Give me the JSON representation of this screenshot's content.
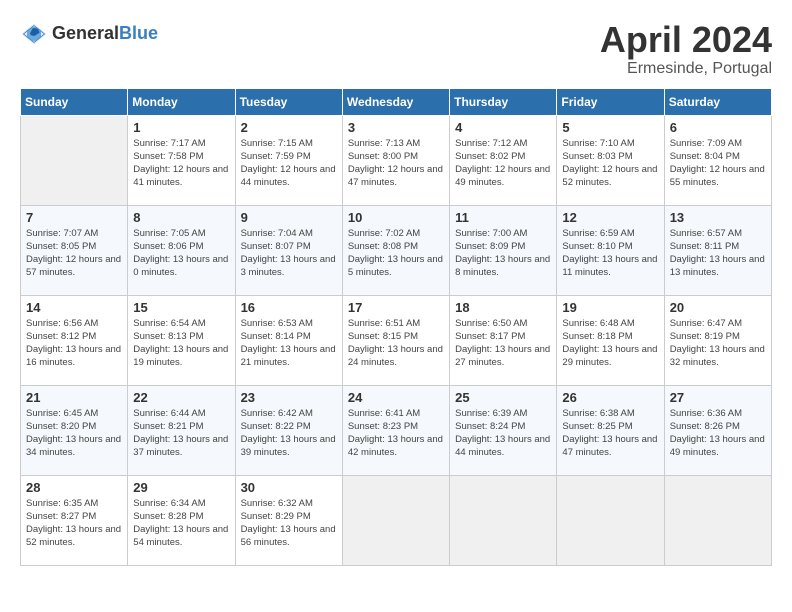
{
  "header": {
    "logo_general": "General",
    "logo_blue": "Blue",
    "title": "April 2024",
    "subtitle": "Ermesinde, Portugal"
  },
  "days_of_week": [
    "Sunday",
    "Monday",
    "Tuesday",
    "Wednesday",
    "Thursday",
    "Friday",
    "Saturday"
  ],
  "weeks": [
    [
      {
        "day": "",
        "sunrise": "",
        "sunset": "",
        "daylight": ""
      },
      {
        "day": "1",
        "sunrise": "Sunrise: 7:17 AM",
        "sunset": "Sunset: 7:58 PM",
        "daylight": "Daylight: 12 hours and 41 minutes."
      },
      {
        "day": "2",
        "sunrise": "Sunrise: 7:15 AM",
        "sunset": "Sunset: 7:59 PM",
        "daylight": "Daylight: 12 hours and 44 minutes."
      },
      {
        "day": "3",
        "sunrise": "Sunrise: 7:13 AM",
        "sunset": "Sunset: 8:00 PM",
        "daylight": "Daylight: 12 hours and 47 minutes."
      },
      {
        "day": "4",
        "sunrise": "Sunrise: 7:12 AM",
        "sunset": "Sunset: 8:02 PM",
        "daylight": "Daylight: 12 hours and 49 minutes."
      },
      {
        "day": "5",
        "sunrise": "Sunrise: 7:10 AM",
        "sunset": "Sunset: 8:03 PM",
        "daylight": "Daylight: 12 hours and 52 minutes."
      },
      {
        "day": "6",
        "sunrise": "Sunrise: 7:09 AM",
        "sunset": "Sunset: 8:04 PM",
        "daylight": "Daylight: 12 hours and 55 minutes."
      }
    ],
    [
      {
        "day": "7",
        "sunrise": "Sunrise: 7:07 AM",
        "sunset": "Sunset: 8:05 PM",
        "daylight": "Daylight: 12 hours and 57 minutes."
      },
      {
        "day": "8",
        "sunrise": "Sunrise: 7:05 AM",
        "sunset": "Sunset: 8:06 PM",
        "daylight": "Daylight: 13 hours and 0 minutes."
      },
      {
        "day": "9",
        "sunrise": "Sunrise: 7:04 AM",
        "sunset": "Sunset: 8:07 PM",
        "daylight": "Daylight: 13 hours and 3 minutes."
      },
      {
        "day": "10",
        "sunrise": "Sunrise: 7:02 AM",
        "sunset": "Sunset: 8:08 PM",
        "daylight": "Daylight: 13 hours and 5 minutes."
      },
      {
        "day": "11",
        "sunrise": "Sunrise: 7:00 AM",
        "sunset": "Sunset: 8:09 PM",
        "daylight": "Daylight: 13 hours and 8 minutes."
      },
      {
        "day": "12",
        "sunrise": "Sunrise: 6:59 AM",
        "sunset": "Sunset: 8:10 PM",
        "daylight": "Daylight: 13 hours and 11 minutes."
      },
      {
        "day": "13",
        "sunrise": "Sunrise: 6:57 AM",
        "sunset": "Sunset: 8:11 PM",
        "daylight": "Daylight: 13 hours and 13 minutes."
      }
    ],
    [
      {
        "day": "14",
        "sunrise": "Sunrise: 6:56 AM",
        "sunset": "Sunset: 8:12 PM",
        "daylight": "Daylight: 13 hours and 16 minutes."
      },
      {
        "day": "15",
        "sunrise": "Sunrise: 6:54 AM",
        "sunset": "Sunset: 8:13 PM",
        "daylight": "Daylight: 13 hours and 19 minutes."
      },
      {
        "day": "16",
        "sunrise": "Sunrise: 6:53 AM",
        "sunset": "Sunset: 8:14 PM",
        "daylight": "Daylight: 13 hours and 21 minutes."
      },
      {
        "day": "17",
        "sunrise": "Sunrise: 6:51 AM",
        "sunset": "Sunset: 8:15 PM",
        "daylight": "Daylight: 13 hours and 24 minutes."
      },
      {
        "day": "18",
        "sunrise": "Sunrise: 6:50 AM",
        "sunset": "Sunset: 8:17 PM",
        "daylight": "Daylight: 13 hours and 27 minutes."
      },
      {
        "day": "19",
        "sunrise": "Sunrise: 6:48 AM",
        "sunset": "Sunset: 8:18 PM",
        "daylight": "Daylight: 13 hours and 29 minutes."
      },
      {
        "day": "20",
        "sunrise": "Sunrise: 6:47 AM",
        "sunset": "Sunset: 8:19 PM",
        "daylight": "Daylight: 13 hours and 32 minutes."
      }
    ],
    [
      {
        "day": "21",
        "sunrise": "Sunrise: 6:45 AM",
        "sunset": "Sunset: 8:20 PM",
        "daylight": "Daylight: 13 hours and 34 minutes."
      },
      {
        "day": "22",
        "sunrise": "Sunrise: 6:44 AM",
        "sunset": "Sunset: 8:21 PM",
        "daylight": "Daylight: 13 hours and 37 minutes."
      },
      {
        "day": "23",
        "sunrise": "Sunrise: 6:42 AM",
        "sunset": "Sunset: 8:22 PM",
        "daylight": "Daylight: 13 hours and 39 minutes."
      },
      {
        "day": "24",
        "sunrise": "Sunrise: 6:41 AM",
        "sunset": "Sunset: 8:23 PM",
        "daylight": "Daylight: 13 hours and 42 minutes."
      },
      {
        "day": "25",
        "sunrise": "Sunrise: 6:39 AM",
        "sunset": "Sunset: 8:24 PM",
        "daylight": "Daylight: 13 hours and 44 minutes."
      },
      {
        "day": "26",
        "sunrise": "Sunrise: 6:38 AM",
        "sunset": "Sunset: 8:25 PM",
        "daylight": "Daylight: 13 hours and 47 minutes."
      },
      {
        "day": "27",
        "sunrise": "Sunrise: 6:36 AM",
        "sunset": "Sunset: 8:26 PM",
        "daylight": "Daylight: 13 hours and 49 minutes."
      }
    ],
    [
      {
        "day": "28",
        "sunrise": "Sunrise: 6:35 AM",
        "sunset": "Sunset: 8:27 PM",
        "daylight": "Daylight: 13 hours and 52 minutes."
      },
      {
        "day": "29",
        "sunrise": "Sunrise: 6:34 AM",
        "sunset": "Sunset: 8:28 PM",
        "daylight": "Daylight: 13 hours and 54 minutes."
      },
      {
        "day": "30",
        "sunrise": "Sunrise: 6:32 AM",
        "sunset": "Sunset: 8:29 PM",
        "daylight": "Daylight: 13 hours and 56 minutes."
      },
      {
        "day": "",
        "sunrise": "",
        "sunset": "",
        "daylight": ""
      },
      {
        "day": "",
        "sunrise": "",
        "sunset": "",
        "daylight": ""
      },
      {
        "day": "",
        "sunrise": "",
        "sunset": "",
        "daylight": ""
      },
      {
        "day": "",
        "sunrise": "",
        "sunset": "",
        "daylight": ""
      }
    ]
  ]
}
